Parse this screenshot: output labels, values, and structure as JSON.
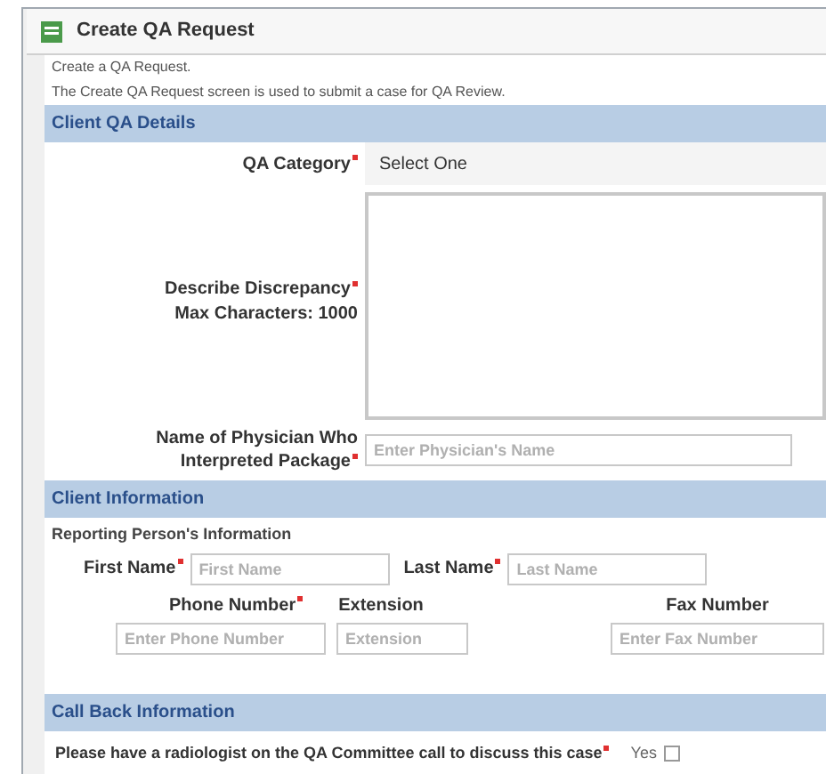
{
  "window": {
    "title": "Create QA Request"
  },
  "intro": [
    "Create a QA Request.",
    "The Create QA Request screen is used to submit a case for QA Review."
  ],
  "sections": [
    {
      "title": "Client QA Details"
    },
    {
      "title": "Client Information"
    },
    {
      "title": "Call Back Information"
    }
  ],
  "qa_category": {
    "label": "QA Category",
    "required": true,
    "value": "Select One"
  },
  "discrepancy": {
    "label": "Describe Discrepancy",
    "required": true,
    "note": "Max Characters: 1000"
  },
  "physician": {
    "label": "Name of Physician Who",
    "label_2": "Interpreted Package",
    "required": true,
    "placeholder": "Enter Physician's Name"
  },
  "reporting_heading": "Reporting Person's Information",
  "first_name": {
    "label": "First Name",
    "required": true,
    "placeholder": "First Name"
  },
  "last_name": {
    "label": "Last Name",
    "required": true,
    "placeholder": "Last Name"
  },
  "phone": {
    "label": "Phone Number",
    "required": true,
    "placeholder": "Enter Phone Number"
  },
  "extension": {
    "label": "Extension",
    "placeholder": "Extension"
  },
  "fax": {
    "label": "Fax Number",
    "required": false,
    "placeholder": "Enter Fax Number"
  },
  "callback": {
    "question": "Please have a radiologist on the QA Committee call to discuss this case",
    "required": true,
    "option": "Yes",
    "checked": false
  }
}
